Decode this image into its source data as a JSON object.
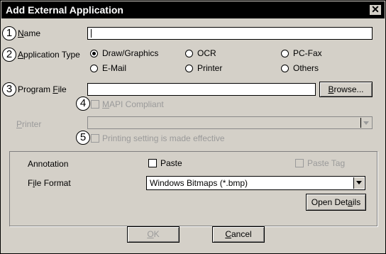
{
  "window": {
    "title": "Add External Application",
    "close_symbol": "✕"
  },
  "markers": [
    "1",
    "2",
    "3",
    "4",
    "5"
  ],
  "name_field": {
    "label_u": "N",
    "label_rest": "ame",
    "value": ""
  },
  "app_type": {
    "label_u": "A",
    "label_rest": "pplication Type",
    "options": [
      "Draw/Graphics",
      "OCR",
      "PC-Fax",
      "E-Mail",
      "Printer",
      "Others"
    ],
    "selected": "Draw/Graphics"
  },
  "program_file": {
    "label_pre": "Program ",
    "label_u": "F",
    "label_rest": "ile",
    "value": "",
    "browse_u": "B",
    "browse_rest": "rowse..."
  },
  "mapi": {
    "label_u": "M",
    "label_rest": "API Compliant"
  },
  "printer": {
    "label_u": "P",
    "label_rest": "rinter",
    "value": ""
  },
  "printing": {
    "label": "Printing setting is made effective"
  },
  "annotation": {
    "label": "Annotation",
    "paste_label": "Paste",
    "paste_tag_label": "Paste Tag"
  },
  "file_format": {
    "label_pre": "F",
    "label_u": "i",
    "label_rest": "le Format",
    "value": "Windows Bitmaps (*.bmp)",
    "open_details_pre": "Open Det",
    "open_details_u": "a",
    "open_details_rest": "ils"
  },
  "buttons": {
    "ok_u": "O",
    "ok_rest": "K",
    "cancel_u": "C",
    "cancel_rest": "ancel"
  }
}
